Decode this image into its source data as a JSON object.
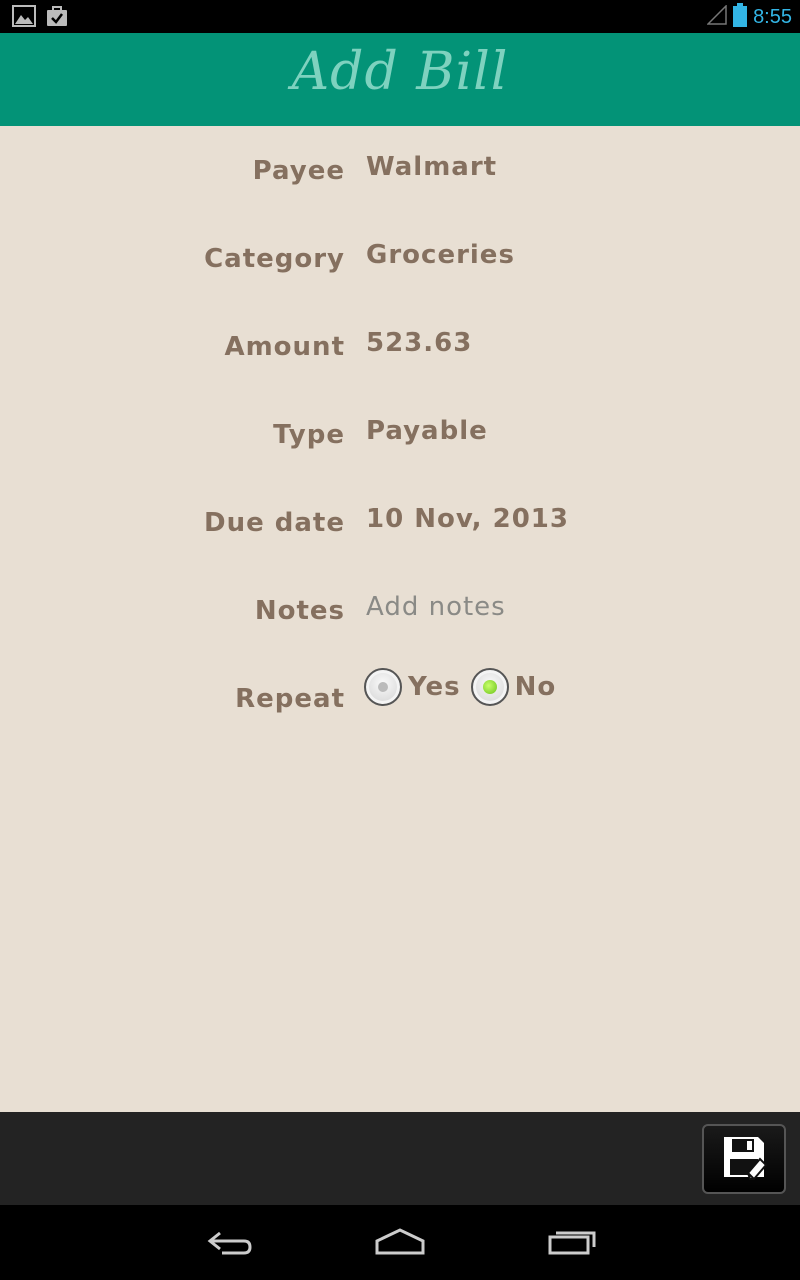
{
  "status_bar": {
    "time": "8:55",
    "left_icons": [
      "image-icon",
      "shopping-bag-icon"
    ],
    "right_icons": [
      "signal-icon",
      "battery-icon"
    ]
  },
  "header": {
    "title": "Add Bill"
  },
  "form": {
    "payee": {
      "label": "Payee",
      "value": "Walmart"
    },
    "category": {
      "label": "Category",
      "value": "Groceries"
    },
    "amount": {
      "label": "Amount",
      "value": "523.63"
    },
    "type": {
      "label": "Type",
      "value": "Payable"
    },
    "due_date": {
      "label": "Due date",
      "value": "10 Nov, 2013"
    },
    "notes": {
      "label": "Notes",
      "placeholder": "Add notes"
    },
    "repeat": {
      "label": "Repeat",
      "options": [
        {
          "label": "Yes",
          "selected": false
        },
        {
          "label": "No",
          "selected": true
        }
      ]
    }
  },
  "toolbar": {
    "save_icon": "save-icon"
  },
  "nav_bar": {
    "icons": [
      "back-icon",
      "home-icon",
      "recents-icon"
    ]
  },
  "colors": {
    "header_bg": "#039377",
    "header_title": "#7ed2bf",
    "page_bg": "#e8dfd3",
    "text": "#85705f",
    "status_accent": "#33b5e5",
    "radio_selected": "#6ac21b"
  }
}
